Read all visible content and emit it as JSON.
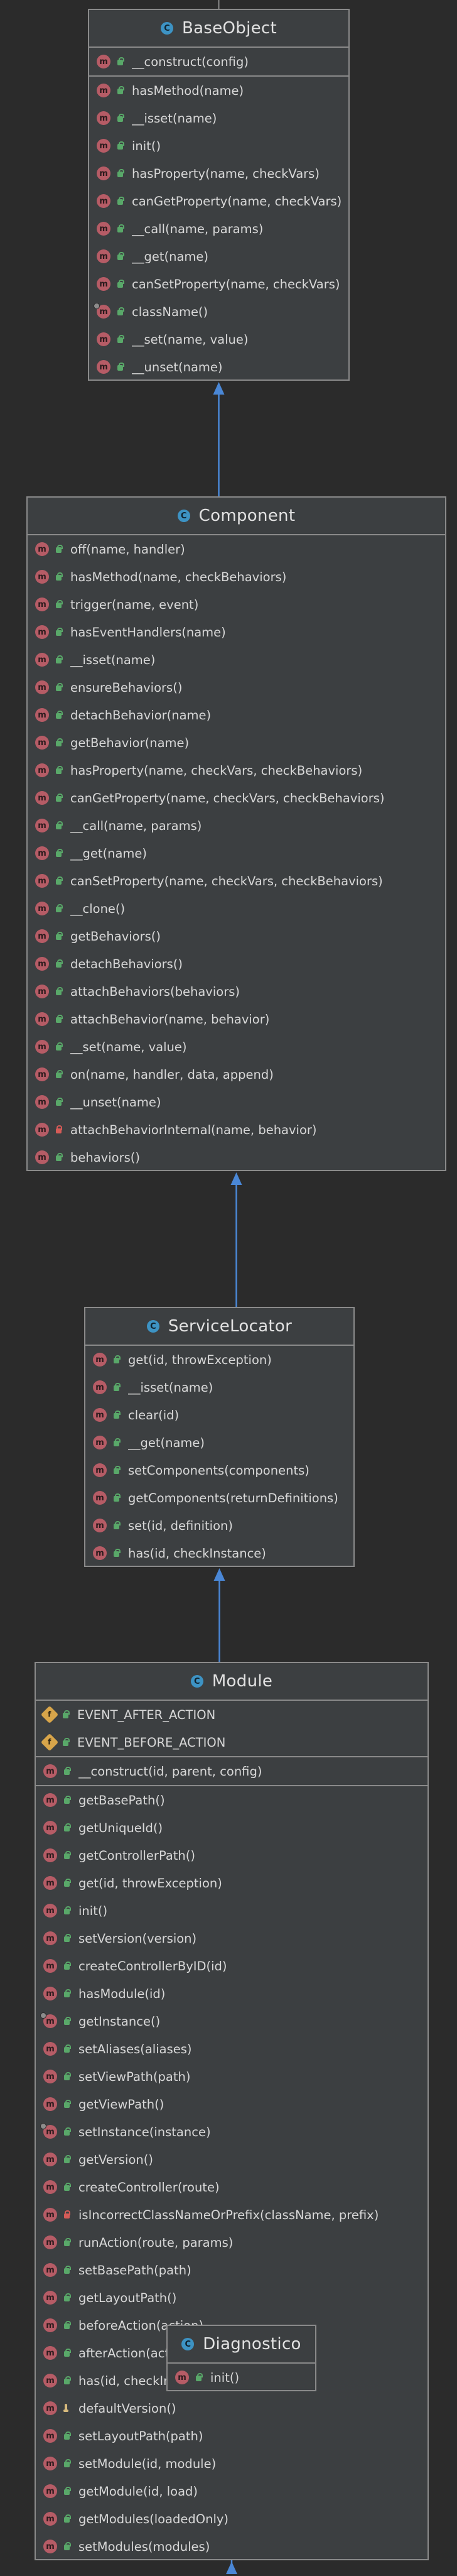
{
  "classes": [
    {
      "name": "BaseObject",
      "sections": [
        [
          {
            "label": "__construct(config)",
            "kind": "method",
            "visibility": "public"
          }
        ],
        [
          {
            "label": "hasMethod(name)",
            "kind": "method",
            "visibility": "public"
          },
          {
            "label": "__isset(name)",
            "kind": "method",
            "visibility": "public"
          },
          {
            "label": "init()",
            "kind": "method",
            "visibility": "public"
          },
          {
            "label": "hasProperty(name, checkVars)",
            "kind": "method",
            "visibility": "public"
          },
          {
            "label": "canGetProperty(name, checkVars)",
            "kind": "method",
            "visibility": "public"
          },
          {
            "label": "__call(name, params)",
            "kind": "method",
            "visibility": "public"
          },
          {
            "label": "__get(name)",
            "kind": "method",
            "visibility": "public"
          },
          {
            "label": "canSetProperty(name, checkVars)",
            "kind": "method",
            "visibility": "public"
          },
          {
            "label": "className()",
            "kind": "method",
            "visibility": "public",
            "static": true
          },
          {
            "label": "__set(name, value)",
            "kind": "method",
            "visibility": "public"
          },
          {
            "label": "__unset(name)",
            "kind": "method",
            "visibility": "public"
          }
        ]
      ]
    },
    {
      "name": "Component",
      "sections": [
        [
          {
            "label": "off(name, handler)",
            "kind": "method",
            "visibility": "public"
          },
          {
            "label": "hasMethod(name, checkBehaviors)",
            "kind": "method",
            "visibility": "public"
          },
          {
            "label": "trigger(name, event)",
            "kind": "method",
            "visibility": "public"
          },
          {
            "label": "hasEventHandlers(name)",
            "kind": "method",
            "visibility": "public"
          },
          {
            "label": "__isset(name)",
            "kind": "method",
            "visibility": "public"
          },
          {
            "label": "ensureBehaviors()",
            "kind": "method",
            "visibility": "public"
          },
          {
            "label": "detachBehavior(name)",
            "kind": "method",
            "visibility": "public"
          },
          {
            "label": "getBehavior(name)",
            "kind": "method",
            "visibility": "public"
          },
          {
            "label": "hasProperty(name, checkVars, checkBehaviors)",
            "kind": "method",
            "visibility": "public"
          },
          {
            "label": "canGetProperty(name, checkVars, checkBehaviors)",
            "kind": "method",
            "visibility": "public"
          },
          {
            "label": "__call(name, params)",
            "kind": "method",
            "visibility": "public"
          },
          {
            "label": "__get(name)",
            "kind": "method",
            "visibility": "public"
          },
          {
            "label": "canSetProperty(name, checkVars, checkBehaviors)",
            "kind": "method",
            "visibility": "public"
          },
          {
            "label": "__clone()",
            "kind": "method",
            "visibility": "public"
          },
          {
            "label": "getBehaviors()",
            "kind": "method",
            "visibility": "public"
          },
          {
            "label": "detachBehaviors()",
            "kind": "method",
            "visibility": "public"
          },
          {
            "label": "attachBehaviors(behaviors)",
            "kind": "method",
            "visibility": "public"
          },
          {
            "label": "attachBehavior(name, behavior)",
            "kind": "method",
            "visibility": "public"
          },
          {
            "label": "__set(name, value)",
            "kind": "method",
            "visibility": "public"
          },
          {
            "label": "on(name, handler, data, append)",
            "kind": "method",
            "visibility": "public"
          },
          {
            "label": "__unset(name)",
            "kind": "method",
            "visibility": "public"
          },
          {
            "label": "attachBehaviorInternal(name, behavior)",
            "kind": "method",
            "visibility": "private"
          },
          {
            "label": "behaviors()",
            "kind": "method",
            "visibility": "public"
          }
        ]
      ]
    },
    {
      "name": "ServiceLocator",
      "sections": [
        [
          {
            "label": "get(id, throwException)",
            "kind": "method",
            "visibility": "public"
          },
          {
            "label": "__isset(name)",
            "kind": "method",
            "visibility": "public"
          },
          {
            "label": "clear(id)",
            "kind": "method",
            "visibility": "public"
          },
          {
            "label": "__get(name)",
            "kind": "method",
            "visibility": "public"
          },
          {
            "label": "setComponents(components)",
            "kind": "method",
            "visibility": "public"
          },
          {
            "label": "getComponents(returnDefinitions)",
            "kind": "method",
            "visibility": "public"
          },
          {
            "label": "set(id, definition)",
            "kind": "method",
            "visibility": "public"
          },
          {
            "label": "has(id, checkInstance)",
            "kind": "method",
            "visibility": "public"
          }
        ]
      ]
    },
    {
      "name": "Module",
      "sections": [
        [
          {
            "label": "EVENT_AFTER_ACTION",
            "kind": "field",
            "visibility": "public"
          },
          {
            "label": "EVENT_BEFORE_ACTION",
            "kind": "field",
            "visibility": "public"
          }
        ],
        [
          {
            "label": "__construct(id, parent, config)",
            "kind": "method",
            "visibility": "public"
          }
        ],
        [
          {
            "label": "getBasePath()",
            "kind": "method",
            "visibility": "public"
          },
          {
            "label": "getUniqueId()",
            "kind": "method",
            "visibility": "public"
          },
          {
            "label": "getControllerPath()",
            "kind": "method",
            "visibility": "public"
          },
          {
            "label": "get(id, throwException)",
            "kind": "method",
            "visibility": "public"
          },
          {
            "label": "init()",
            "kind": "method",
            "visibility": "public"
          },
          {
            "label": "setVersion(version)",
            "kind": "method",
            "visibility": "public"
          },
          {
            "label": "createControllerByID(id)",
            "kind": "method",
            "visibility": "public"
          },
          {
            "label": "hasModule(id)",
            "kind": "method",
            "visibility": "public"
          },
          {
            "label": "getInstance()",
            "kind": "method",
            "visibility": "public",
            "static": true
          },
          {
            "label": "setAliases(aliases)",
            "kind": "method",
            "visibility": "public"
          },
          {
            "label": "setViewPath(path)",
            "kind": "method",
            "visibility": "public"
          },
          {
            "label": "getViewPath()",
            "kind": "method",
            "visibility": "public"
          },
          {
            "label": "setInstance(instance)",
            "kind": "method",
            "visibility": "public",
            "static": true
          },
          {
            "label": "getVersion()",
            "kind": "method",
            "visibility": "public"
          },
          {
            "label": "createController(route)",
            "kind": "method",
            "visibility": "public"
          },
          {
            "label": "isIncorrectClassNameOrPrefix(className, prefix)",
            "kind": "method",
            "visibility": "private"
          },
          {
            "label": "runAction(route, params)",
            "kind": "method",
            "visibility": "public"
          },
          {
            "label": "setBasePath(path)",
            "kind": "method",
            "visibility": "public"
          },
          {
            "label": "getLayoutPath()",
            "kind": "method",
            "visibility": "public"
          },
          {
            "label": "beforeAction(action)",
            "kind": "method",
            "visibility": "public"
          },
          {
            "label": "afterAction(action, result)",
            "kind": "method",
            "visibility": "public"
          },
          {
            "label": "has(id, checkInstance)",
            "kind": "method",
            "visibility": "public"
          },
          {
            "label": "defaultVersion()",
            "kind": "method",
            "visibility": "protected"
          },
          {
            "label": "setLayoutPath(path)",
            "kind": "method",
            "visibility": "public"
          },
          {
            "label": "setModule(id, module)",
            "kind": "method",
            "visibility": "public"
          },
          {
            "label": "getModule(id, load)",
            "kind": "method",
            "visibility": "public"
          },
          {
            "label": "getModules(loadedOnly)",
            "kind": "method",
            "visibility": "public"
          },
          {
            "label": "setModules(modules)",
            "kind": "method",
            "visibility": "public"
          }
        ]
      ]
    },
    {
      "name": "Diagnostico",
      "sections": [
        [
          {
            "label": "init()",
            "kind": "method",
            "visibility": "public"
          }
        ]
      ]
    }
  ],
  "inheritance": [
    {
      "child": "Component",
      "parent": "BaseObject"
    },
    {
      "child": "ServiceLocator",
      "parent": "Component"
    },
    {
      "child": "Module",
      "parent": "ServiceLocator"
    },
    {
      "child": "Diagnostico",
      "parent": "Module"
    }
  ],
  "colors": {
    "background": "#2b2b2b",
    "box": "#3c3f41",
    "border": "#8a8a8a",
    "arrow": "#4a87d6",
    "method_icon": "#b65c66",
    "field_icon": "#d8a54a",
    "class_icon": "#3d93c4"
  },
  "icons": {
    "class": "class-icon",
    "method": "method-icon",
    "field": "field-icon",
    "public": "unlocked-icon",
    "private": "lock-icon",
    "protected": "key-icon",
    "static": "static-marker-icon"
  },
  "icon_letters": {
    "class": "C",
    "method": "m",
    "field": "f"
  }
}
